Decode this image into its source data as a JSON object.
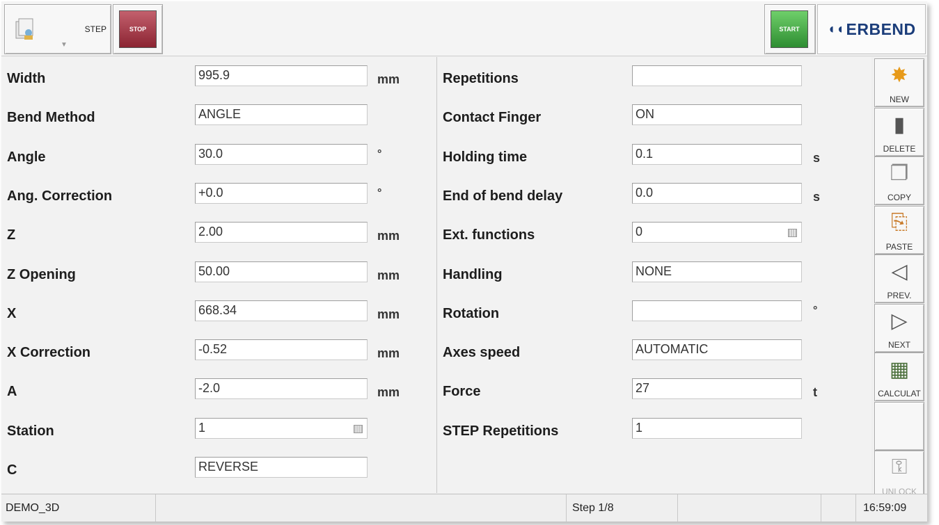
{
  "toolbar": {
    "step_label": "STEP",
    "stop_label": "STOP",
    "start_label": "START",
    "logo_text": "ERBEND",
    "stop_color": "#8b2432",
    "start_color": "#2e8d32"
  },
  "left_fields": [
    {
      "label": "Width",
      "value": "995.9",
      "unit": "mm"
    },
    {
      "label": "Bend Method",
      "value": "ANGLE",
      "unit": ""
    },
    {
      "label": "Angle",
      "value": "30.0",
      "unit": "°"
    },
    {
      "label": "Ang. Correction",
      "value": "+0.0",
      "unit": "°"
    },
    {
      "label": "Z",
      "value": "2.00",
      "unit": "mm"
    },
    {
      "label": "Z Opening",
      "value": "50.00",
      "unit": "mm"
    },
    {
      "label": "X",
      "value": "668.34",
      "unit": "mm"
    },
    {
      "label": "X Correction",
      "value": "-0.52",
      "unit": "mm"
    },
    {
      "label": "A",
      "value": "-2.0",
      "unit": "mm"
    },
    {
      "label": "Station",
      "value": "1",
      "unit": ""
    },
    {
      "label": "C",
      "value": "REVERSE",
      "unit": ""
    }
  ],
  "right_fields": [
    {
      "label": "Repetitions",
      "value": "",
      "unit": ""
    },
    {
      "label": "Contact Finger",
      "value": "ON",
      "unit": ""
    },
    {
      "label": "Holding time",
      "value": "0.1",
      "unit": "s"
    },
    {
      "label": "End of bend delay",
      "value": "0.0",
      "unit": "s"
    },
    {
      "label": "Ext. functions",
      "value": "0",
      "unit": ""
    },
    {
      "label": "Handling",
      "value": "NONE",
      "unit": ""
    },
    {
      "label": "Rotation",
      "value": "",
      "unit": "°"
    },
    {
      "label": "Axes speed",
      "value": "AUTOMATIC",
      "unit": ""
    },
    {
      "label": "Force",
      "value": "27",
      "unit": "t"
    },
    {
      "label": "STEP Repetitions",
      "value": "1",
      "unit": ""
    }
  ],
  "sidebar": [
    {
      "label": "NEW",
      "icon": "new-icon"
    },
    {
      "label": "DELETE",
      "icon": "delete-icon"
    },
    {
      "label": "COPY",
      "icon": "copy-icon"
    },
    {
      "label": "PASTE",
      "icon": "paste-icon"
    },
    {
      "label": "PREV.",
      "icon": "prev-icon"
    },
    {
      "label": "NEXT",
      "icon": "next-icon"
    },
    {
      "label": "CALCULAT",
      "icon": "calculator-icon"
    },
    {
      "label": "",
      "icon": ""
    },
    {
      "label": "UNLOCK",
      "icon": "key-icon"
    }
  ],
  "status": {
    "program": "DEMO_3D",
    "step": "Step 1/8",
    "time": "16:59:09"
  }
}
